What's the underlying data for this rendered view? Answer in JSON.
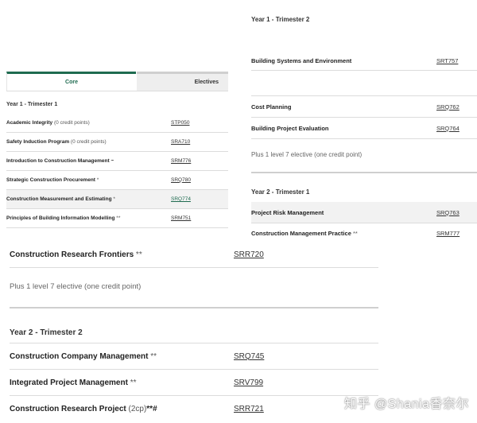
{
  "right_top": {
    "heading": "Year 1 - Trimester 2",
    "rows": [
      {
        "name": "Building Systems and Environment",
        "code": "SRT757"
      },
      {
        "name": "Cost Planning",
        "code": "SRQ762"
      },
      {
        "name": "Building Project Evaluation",
        "code": "SRQ764"
      }
    ],
    "note": "Plus 1 level 7 elective (one credit point)"
  },
  "right_mid": {
    "heading": "Year 2 - Trimester 1",
    "rows": [
      {
        "name": "Project Risk Management",
        "code": "SRQ763"
      },
      {
        "name": "Construction Management Practice",
        "suffix": " **",
        "code": "SRM777"
      }
    ]
  },
  "tabs": {
    "core": "Core",
    "electives": "Electives"
  },
  "left_top": {
    "heading": "Year 1 - Trimester 1",
    "rows": [
      {
        "name": "Academic Integrity",
        "cp": " (0 credit points)",
        "code": "STP050"
      },
      {
        "name": "Safety Induction Program",
        "cp": " (0 credit points)",
        "code": "SRA710"
      },
      {
        "name": "Introduction to Construction Management ~",
        "code": "SRM776"
      },
      {
        "name": "Strategic Construction Procurement",
        "suffix": " *",
        "code": "SRQ780"
      },
      {
        "name": "Construction Measurement and Estimating",
        "suffix": " *",
        "code": "SRQ774"
      },
      {
        "name": "Principles of Building Information Modelling",
        "suffix": " **",
        "code": "SRM751"
      }
    ]
  },
  "bottom": {
    "first_row": {
      "name": "Construction Research Frontiers",
      "suffix": " **",
      "code": "SRR720"
    },
    "note": "Plus 1 level 7 elective (one credit point)",
    "heading": "Year 2 - Trimester 2",
    "rows": [
      {
        "name": "Construction Company Management",
        "suffix": " **",
        "code": "SRQ745"
      },
      {
        "name": "Integrated Project Management",
        "suffix": " **",
        "code": "SRV799"
      },
      {
        "name": "Construction Research Project",
        "cp": " (2cp)",
        "suffix": "**#",
        "code": "SRR721"
      }
    ]
  },
  "watermark": "知乎 @Shania香奈尔"
}
